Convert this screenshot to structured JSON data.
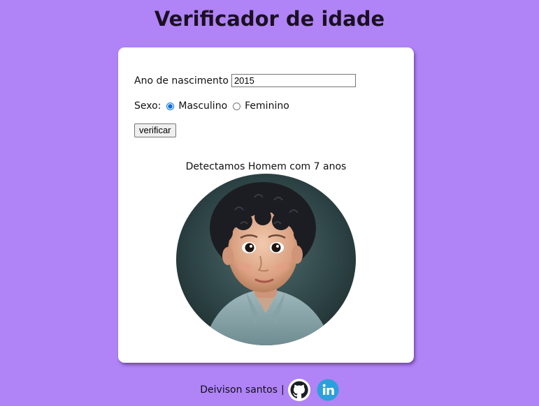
{
  "page": {
    "title": "Verificador de idade"
  },
  "form": {
    "year_label": "Ano de nascimento",
    "year_value": "2015",
    "sex_label": "Sexo:",
    "options": [
      {
        "label": "Masculino",
        "checked": true
      },
      {
        "label": "Feminino",
        "checked": false
      }
    ],
    "submit_label": "verificar"
  },
  "result": {
    "text": "Detectamos Homem com 7 anos",
    "image": "child-boy-portrait"
  },
  "footer": {
    "author": "Deivison santos",
    "separator": "|",
    "icons": [
      "github-icon",
      "linkedin-icon"
    ]
  },
  "colors": {
    "background": "#b083f6",
    "card": "#ffffff",
    "radio_accent": "#0b6ee6",
    "linkedin": "#2d9fd9"
  }
}
